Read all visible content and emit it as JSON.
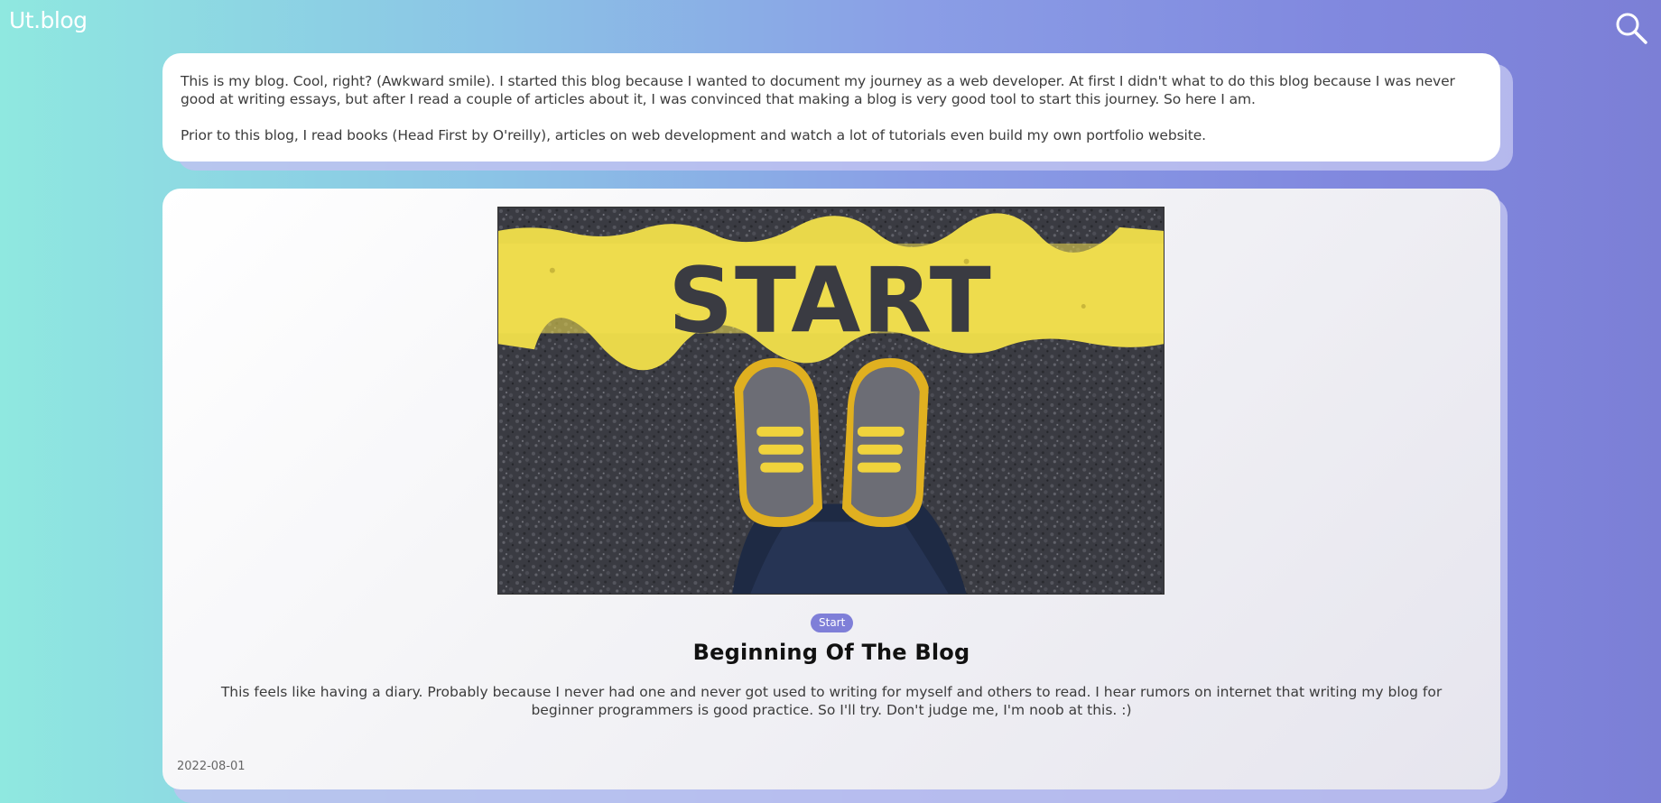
{
  "header": {
    "logo": "Ut.blog",
    "search_icon": "search-icon"
  },
  "intro": {
    "paragraphs": [
      "This is my blog. Cool, right? (Awkward smile). I started this blog because I wanted to document my journey as a web developer. At first I didn't what to do this blog because I was never good at writing essays, but after I read a couple of articles about it, I was convinced that making a blog is very good tool to start this journey. So here I am.",
      "Prior to this blog, I read books (Head First by O'reilly), articles on web development and watch a lot of tutorials even build my own portfolio website."
    ]
  },
  "post": {
    "image_text": "START",
    "tag": "Start",
    "title": "Beginning Of The Blog",
    "excerpt": "This feels like having a diary. Probably because I never had one and never got used to writing for myself and others to read. I hear rumors on internet that writing my blog for beginner programmers is good practice. So I'll try. Don't judge me, I'm noob at this. :)",
    "date": "2022-08-01"
  },
  "colors": {
    "accent": "#7f7fd8",
    "gradient_start": "#8fe8e0",
    "gradient_end": "#7c7fd6"
  }
}
